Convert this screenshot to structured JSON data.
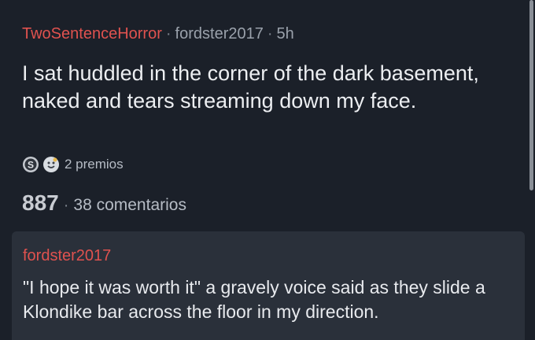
{
  "post": {
    "subreddit": "TwoSentenceHorror",
    "separator": "·",
    "author": "fordster2017",
    "age": "5h",
    "title": "I sat huddled in the corner of the dark basement, naked and tears streaming down my face.",
    "awards": {
      "icons": [
        "silver-award-icon",
        "wholesome-award-icon"
      ],
      "label": "2 premios"
    },
    "score": "887",
    "comments_label": "38 comentarios"
  },
  "comment": {
    "author": "fordster2017",
    "body": "\"I hope it was worth it\" a gravely voice said as they slide a Klondike bar across the floor in my direction."
  },
  "colors": {
    "background": "#1b2029",
    "card": "#2a303a",
    "accent": "#e0524f",
    "text": "#e8eaee",
    "muted": "#9aa1ab"
  }
}
